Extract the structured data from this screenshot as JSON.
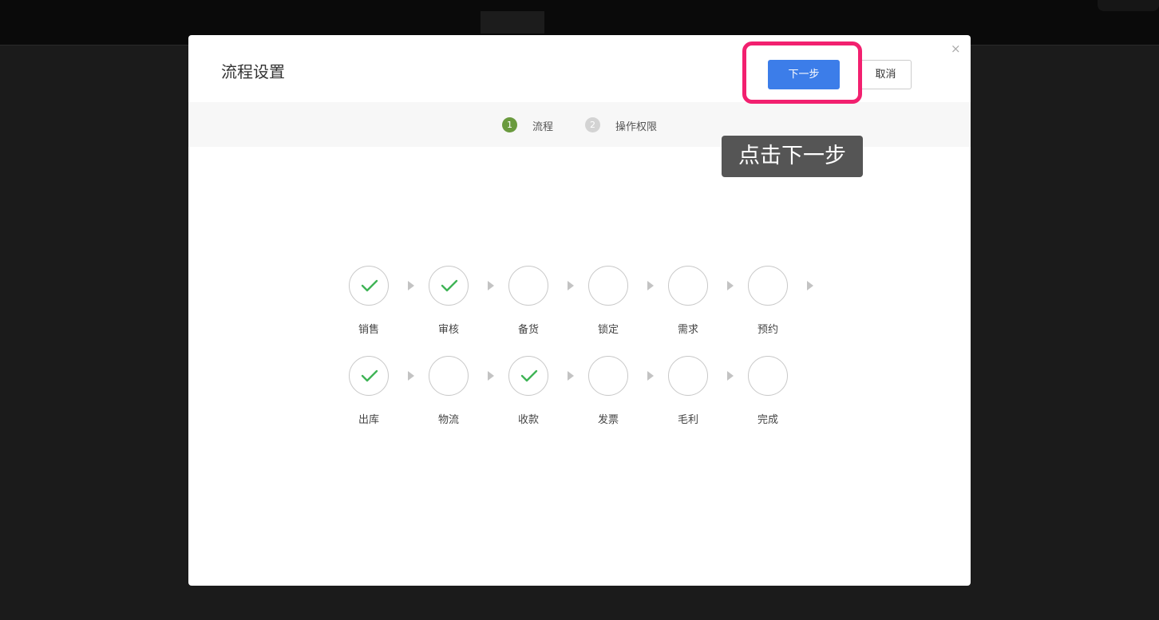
{
  "modal": {
    "title": "流程设置",
    "close_label": "×",
    "next_label": "下一步",
    "cancel_label": "取消"
  },
  "tooltip": {
    "text": "点击下一步"
  },
  "highlight_color": "#f2206f",
  "steps": [
    {
      "num": "1",
      "label": "流程",
      "active": true
    },
    {
      "num": "2",
      "label": "操作权限",
      "active": false
    }
  ],
  "flow_rows": [
    [
      {
        "label": "销售",
        "checked": true
      },
      {
        "label": "审核",
        "checked": true
      },
      {
        "label": "备货",
        "checked": false
      },
      {
        "label": "锁定",
        "checked": false
      },
      {
        "label": "需求",
        "checked": false
      },
      {
        "label": "预约",
        "checked": false
      }
    ],
    [
      {
        "label": "出库",
        "checked": true
      },
      {
        "label": "物流",
        "checked": false
      },
      {
        "label": "收款",
        "checked": true
      },
      {
        "label": "发票",
        "checked": false
      },
      {
        "label": "毛利",
        "checked": false
      },
      {
        "label": "完成",
        "checked": false
      }
    ]
  ],
  "colors": {
    "primary": "#3c7de9",
    "step_active": "#6a9a3e",
    "check": "#3fb456"
  }
}
